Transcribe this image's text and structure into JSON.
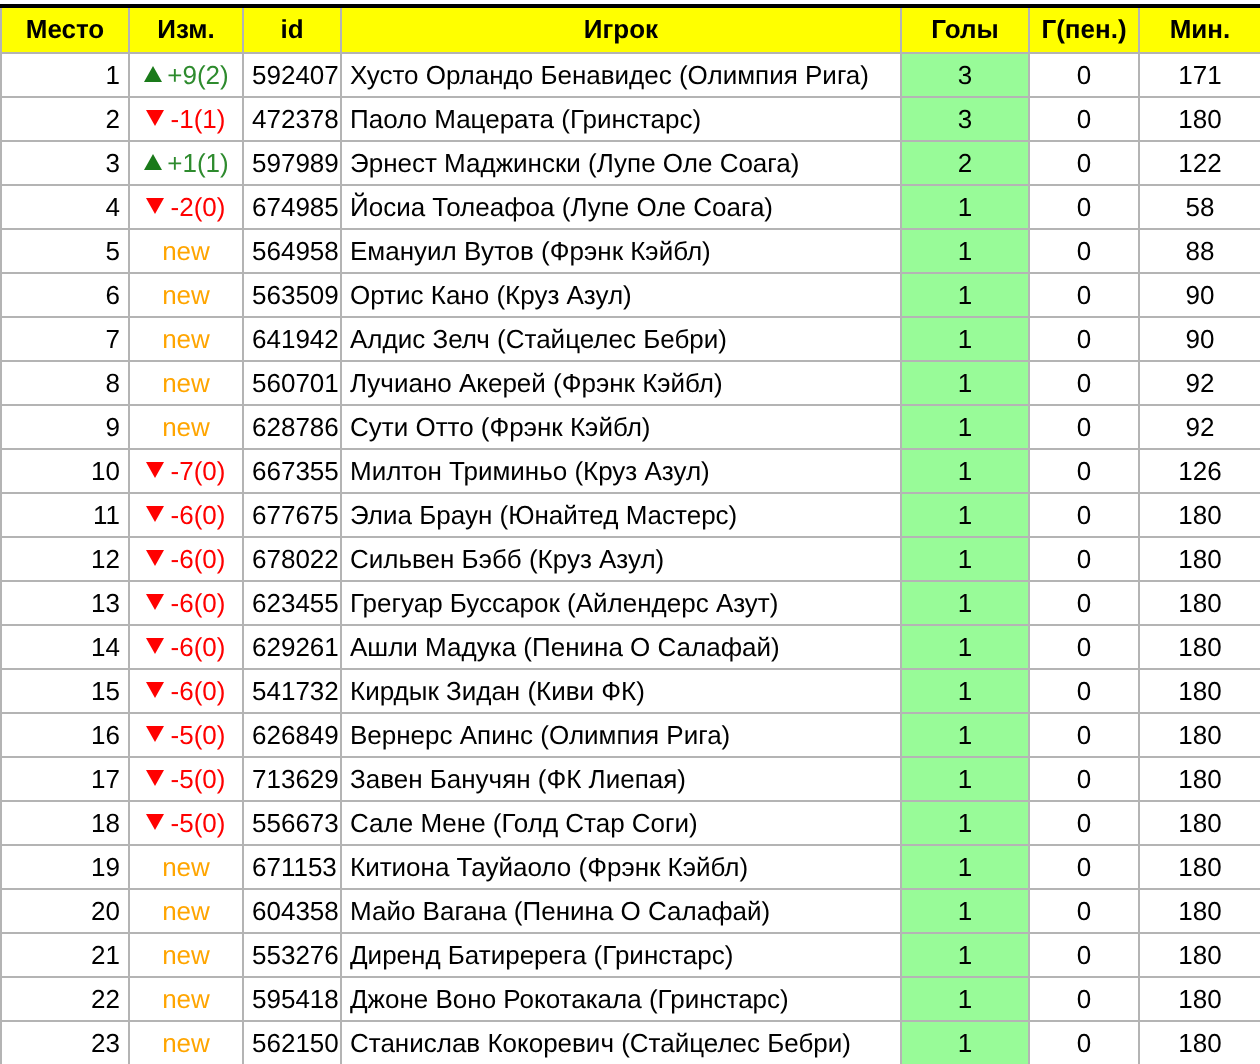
{
  "table": {
    "columns": [
      "Место",
      "Изм.",
      "id",
      "Игрок",
      "Голы",
      "Г(пен.)",
      "Мин."
    ],
    "rows": [
      {
        "place": "1",
        "change": {
          "kind": "up",
          "text": "+9(2)"
        },
        "id": "592407",
        "player": "Хусто Орландо Бенавидес (Олимпия Рига)",
        "goals": "3",
        "pen": "0",
        "min": "171"
      },
      {
        "place": "2",
        "change": {
          "kind": "down",
          "text": "-1(1)"
        },
        "id": "472378",
        "player": "Паоло Мацерата (Гринстарс)",
        "goals": "3",
        "pen": "0",
        "min": "180"
      },
      {
        "place": "3",
        "change": {
          "kind": "up",
          "text": "+1(1)"
        },
        "id": "597989",
        "player": "Эрнест Маджински (Лупе Оле Соага)",
        "goals": "2",
        "pen": "0",
        "min": "122"
      },
      {
        "place": "4",
        "change": {
          "kind": "down",
          "text": "-2(0)"
        },
        "id": "674985",
        "player": "Йосиа Толеафоа (Лупе Оле Соага)",
        "goals": "1",
        "pen": "0",
        "min": "58"
      },
      {
        "place": "5",
        "change": {
          "kind": "new",
          "text": "new"
        },
        "id": "564958",
        "player": "Емануил Вутов (Фрэнк Кэйбл)",
        "goals": "1",
        "pen": "0",
        "min": "88"
      },
      {
        "place": "6",
        "change": {
          "kind": "new",
          "text": "new"
        },
        "id": "563509",
        "player": "Ортис Кано (Круз Азул)",
        "goals": "1",
        "pen": "0",
        "min": "90"
      },
      {
        "place": "7",
        "change": {
          "kind": "new",
          "text": "new"
        },
        "id": "641942",
        "player": "Алдис Зелч (Стайцелес Бебри)",
        "goals": "1",
        "pen": "0",
        "min": "90"
      },
      {
        "place": "8",
        "change": {
          "kind": "new",
          "text": "new"
        },
        "id": "560701",
        "player": "Лучиано Акерей (Фрэнк Кэйбл)",
        "goals": "1",
        "pen": "0",
        "min": "92"
      },
      {
        "place": "9",
        "change": {
          "kind": "new",
          "text": "new"
        },
        "id": "628786",
        "player": "Сути Отто (Фрэнк Кэйбл)",
        "goals": "1",
        "pen": "0",
        "min": "92"
      },
      {
        "place": "10",
        "change": {
          "kind": "down",
          "text": "-7(0)"
        },
        "id": "667355",
        "player": "Милтон Триминьо (Круз Азул)",
        "goals": "1",
        "pen": "0",
        "min": "126"
      },
      {
        "place": "11",
        "change": {
          "kind": "down",
          "text": "-6(0)"
        },
        "id": "677675",
        "player": "Элиа Браун (Юнайтед Мастерс)",
        "goals": "1",
        "pen": "0",
        "min": "180"
      },
      {
        "place": "12",
        "change": {
          "kind": "down",
          "text": "-6(0)"
        },
        "id": "678022",
        "player": "Сильвен Бэбб (Круз Азул)",
        "goals": "1",
        "pen": "0",
        "min": "180"
      },
      {
        "place": "13",
        "change": {
          "kind": "down",
          "text": "-6(0)"
        },
        "id": "623455",
        "player": "Грегуар Буссарок (Айлендерс Азут)",
        "goals": "1",
        "pen": "0",
        "min": "180"
      },
      {
        "place": "14",
        "change": {
          "kind": "down",
          "text": "-6(0)"
        },
        "id": "629261",
        "player": "Ашли Мадука (Пенина О Салафай)",
        "goals": "1",
        "pen": "0",
        "min": "180"
      },
      {
        "place": "15",
        "change": {
          "kind": "down",
          "text": "-6(0)"
        },
        "id": "541732",
        "player": "Кирдык Зидан (Киви ФК)",
        "goals": "1",
        "pen": "0",
        "min": "180"
      },
      {
        "place": "16",
        "change": {
          "kind": "down",
          "text": "-5(0)"
        },
        "id": "626849",
        "player": "Вернерс Апинс (Олимпия Рига)",
        "goals": "1",
        "pen": "0",
        "min": "180"
      },
      {
        "place": "17",
        "change": {
          "kind": "down",
          "text": "-5(0)"
        },
        "id": "713629",
        "player": "Завен Банучян (ФК Лиепая)",
        "goals": "1",
        "pen": "0",
        "min": "180"
      },
      {
        "place": "18",
        "change": {
          "kind": "down",
          "text": "-5(0)"
        },
        "id": "556673",
        "player": "Сале Мене (Голд Стар Соги)",
        "goals": "1",
        "pen": "0",
        "min": "180"
      },
      {
        "place": "19",
        "change": {
          "kind": "new",
          "text": "new"
        },
        "id": "671153",
        "player": "Китиона Тауйаоло (Фрэнк Кэйбл)",
        "goals": "1",
        "pen": "0",
        "min": "180"
      },
      {
        "place": "20",
        "change": {
          "kind": "new",
          "text": "new"
        },
        "id": "604358",
        "player": "Майо Вагана (Пенина О Салафай)",
        "goals": "1",
        "pen": "0",
        "min": "180"
      },
      {
        "place": "21",
        "change": {
          "kind": "new",
          "text": "new"
        },
        "id": "553276",
        "player": "Диренд Батиререга (Гринстарс)",
        "goals": "1",
        "pen": "0",
        "min": "180"
      },
      {
        "place": "22",
        "change": {
          "kind": "new",
          "text": "new"
        },
        "id": "595418",
        "player": "Джоне Воно Рокотакала (Гринстарс)",
        "goals": "1",
        "pen": "0",
        "min": "180"
      },
      {
        "place": "23",
        "change": {
          "kind": "new",
          "text": "new"
        },
        "id": "562150",
        "player": "Станислав Кокоревич (Стайцелес Бебри)",
        "goals": "1",
        "pen": "0",
        "min": "180"
      }
    ]
  }
}
